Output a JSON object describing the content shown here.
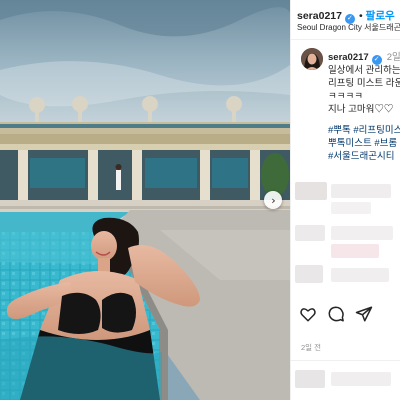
{
  "post": {
    "username": "sera0217",
    "follow_label": "팔로우",
    "location": "Seoul Dragon City 서울드래곤시티",
    "relative_time": "2일",
    "caption_lines": [
      "일상에서 관리하는 리프팅",
      "리프팅 미스트 라운딩",
      "ㅋㅋㅋㅋ",
      "지나 고마워♡♡"
    ],
    "hashtag_lines": [
      "#뿌톡 #리프팅미스트",
      "뿌톡미스트 #브롬",
      "#서울드래곤시티"
    ],
    "posted_ago": "2일 전"
  },
  "icons": {
    "verified": "verified-badge-icon",
    "like": "heart-icon",
    "comment": "comment-icon",
    "share": "paper-plane-icon",
    "next": "chevron-right-icon"
  },
  "colors": {
    "follow_blue": "#0095f6",
    "verified_blue": "#3897f0",
    "hashtag": "#00376b",
    "muted": "#8e8e8e"
  }
}
